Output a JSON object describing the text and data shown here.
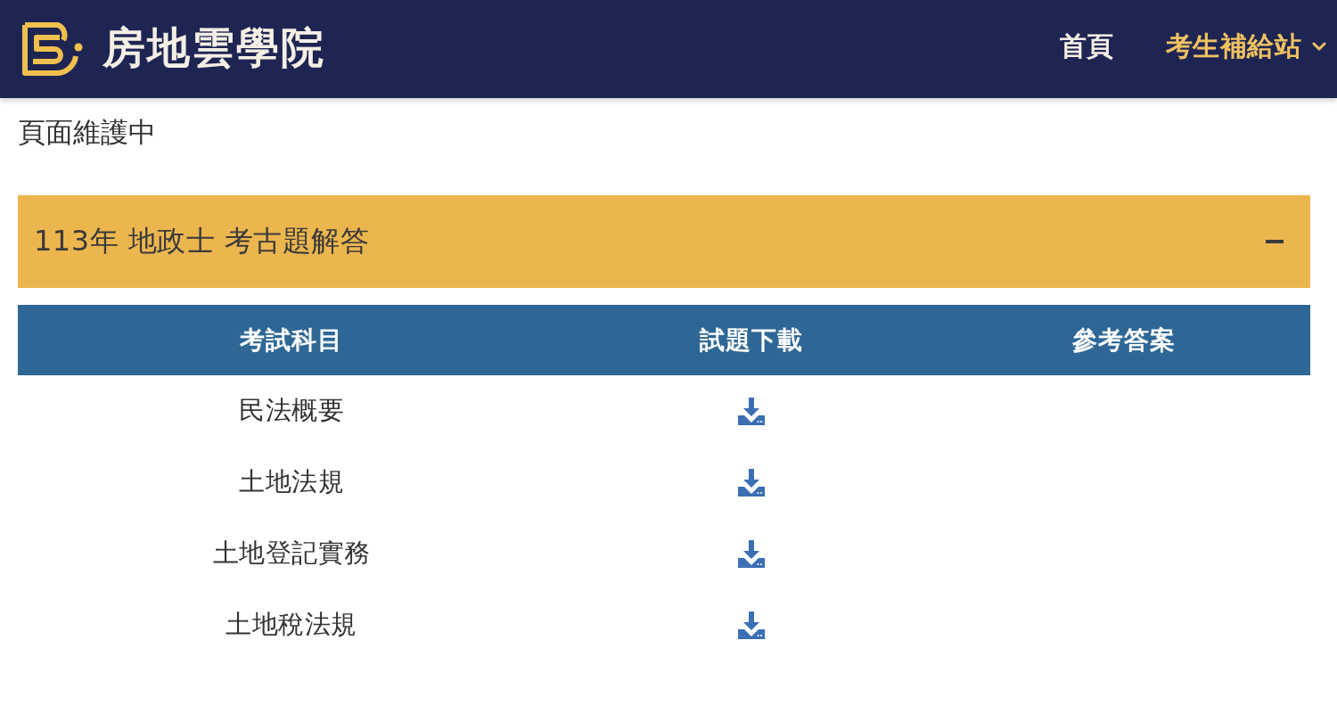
{
  "header": {
    "site_name": "房地雲學院",
    "nav": [
      {
        "label": "首頁",
        "selected": false,
        "kind": "link"
      },
      {
        "label": "考生補給站",
        "selected": true,
        "kind": "dropdown"
      }
    ]
  },
  "notice": "頁面維護中",
  "section": {
    "title": "113年 地政士 考古題解答",
    "expanded": true,
    "table": {
      "columns": [
        "考試科目",
        "試題下載",
        "參考答案"
      ],
      "rows": [
        {
          "subject": "民法概要",
          "download": true
        },
        {
          "subject": "土地法規",
          "download": true
        },
        {
          "subject": "土地登記實務",
          "download": true
        },
        {
          "subject": "土地稅法規",
          "download": true
        }
      ]
    }
  }
}
